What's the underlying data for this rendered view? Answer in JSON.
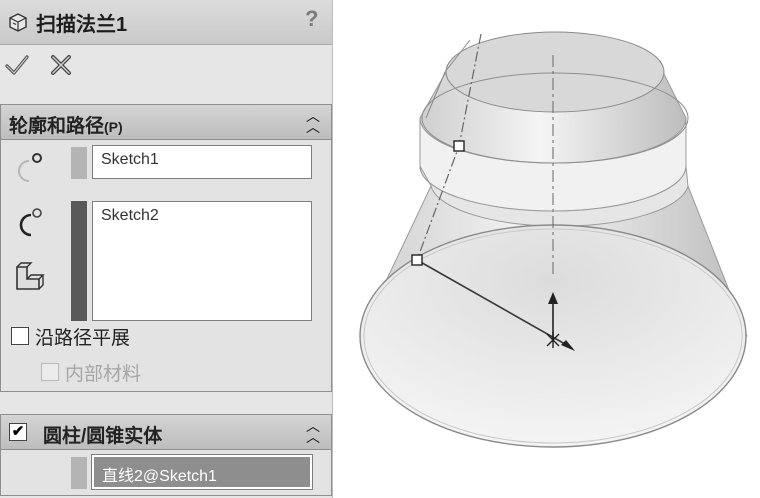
{
  "panel": {
    "title": "扫描法兰1",
    "help": "?",
    "ok_icon": "checkmark-icon",
    "cancel_icon": "x-icon"
  },
  "profile_path": {
    "title": "轮廓和路径",
    "title_suffix": "(P)",
    "collapse": "chevron-double-up-icon",
    "profile_value": "Sketch1",
    "path_value": "Sketch2",
    "flatten_label": "沿路径平展",
    "flatten_checked": false,
    "inner_material_label": "内部材料",
    "inner_material_checked": false
  },
  "cyl_cone": {
    "title": "圆柱/圆锥实体",
    "checked": true,
    "check_mark": "✔",
    "collapse": "chevron-double-up-icon",
    "value": "直线2@Sketch1"
  },
  "colors": {
    "panel_bg": "#e6e6e6",
    "swatch_light": "#b4b4b4",
    "swatch_dark": "#595959"
  }
}
